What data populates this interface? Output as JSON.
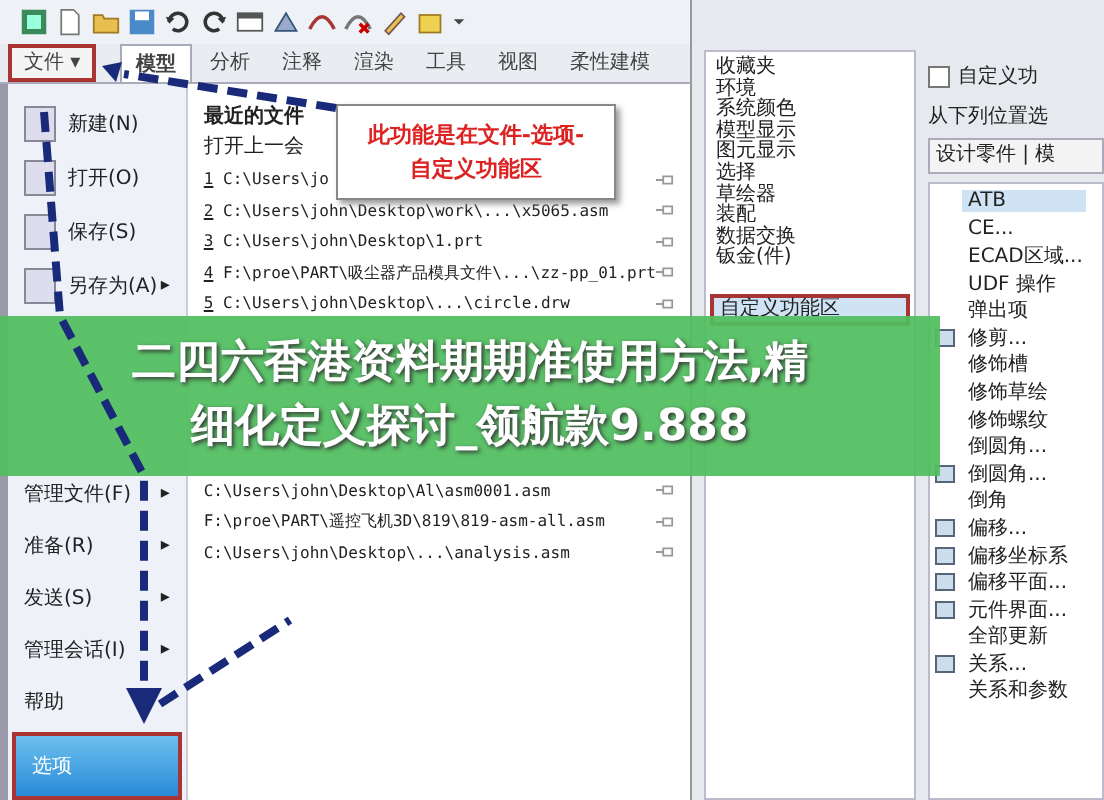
{
  "tabs": [
    {
      "label": "文件",
      "caret": "▾",
      "kind": "menu",
      "selected": false
    },
    {
      "label": "模型",
      "kind": "tab",
      "selected": true
    },
    {
      "label": "分析",
      "kind": "tab",
      "selected": false
    },
    {
      "label": "注释",
      "kind": "tab",
      "selected": false
    },
    {
      "label": "渲染",
      "kind": "tab",
      "selected": false
    },
    {
      "label": "工具",
      "kind": "tab",
      "selected": false
    },
    {
      "label": "视图",
      "kind": "tab",
      "selected": false
    },
    {
      "label": "柔性建模",
      "kind": "tab",
      "selected": false
    }
  ],
  "file_menu": {
    "items_top": [
      {
        "label": "新建(N)",
        "selected": false
      },
      {
        "label": "打开(O)",
        "selected": false
      },
      {
        "label": "保存(S)",
        "selected": false
      },
      {
        "label": "另存为(A)",
        "arrow": "▸",
        "selected": false
      }
    ],
    "items_bottom": [
      {
        "label": "管理文件(F)",
        "arrow": "▸",
        "selected": false
      },
      {
        "label": "准备(R)",
        "arrow": "▸",
        "selected": false
      },
      {
        "label": "发送(S)",
        "arrow": "▸",
        "selected": false
      },
      {
        "label": "管理会话(I)",
        "arrow": "▸",
        "selected": false
      },
      {
        "label": "帮助",
        "selected": false
      },
      {
        "label": "选项",
        "selected": true
      }
    ]
  },
  "recent_files": {
    "header": "最近的文件",
    "reopen": "打开上一会",
    "rows_top": [
      {
        "number": "1",
        "path": "C:\\Users\\jo"
      },
      {
        "number": "2",
        "path": "C:\\Users\\john\\Desktop\\work\\...\\x5065.asm"
      },
      {
        "number": "3",
        "path": "C:\\Users\\john\\Desktop\\1.prt"
      },
      {
        "number": "4",
        "path": "F:\\proe\\PART\\吸尘器产品模具文件\\...\\zz-pp_01.prt"
      },
      {
        "number": "5",
        "path": "C:\\Users\\john\\Desktop\\...\\circle.drw"
      }
    ],
    "rows_bottom": [
      {
        "path": "C:\\Users\\john\\Desktop\\Al\\asm0001.asm"
      },
      {
        "path": "F:\\proe\\PART\\遥控飞机3D\\819\\819-asm-all.asm"
      },
      {
        "path": "C:\\Users\\john\\Desktop\\...\\analysis.asm"
      }
    ]
  },
  "callout": {
    "lines": [
      "此功能是在文件-选项-",
      "自定义功能区"
    ]
  },
  "options_dialog": {
    "categories": [
      {
        "label": "收藏夹",
        "selected": false
      },
      {
        "label": "环境",
        "selected": false
      },
      {
        "label": "系统颜色",
        "selected": false
      },
      {
        "label": "模型显示",
        "selected": false
      },
      {
        "label": "图元显示",
        "selected": false
      },
      {
        "label": "选择",
        "selected": false
      },
      {
        "label": "草绘器",
        "selected": false
      },
      {
        "label": "装配",
        "selected": false
      },
      {
        "label": "数据交换",
        "selected": false
      },
      {
        "label": "钣金(件)",
        "selected": false
      },
      {
        "label": "自定义功能区",
        "selected": true
      }
    ],
    "customize_checkbox": {
      "label": "自定义功",
      "checked": false
    },
    "choose_from": "从下列位置选",
    "source_dropdown": "设计零件 | 模",
    "commands": [
      {
        "label": "ATB",
        "kind": "plain",
        "selected": true
      },
      {
        "label": "CE...",
        "kind": "plain",
        "selected": false
      },
      {
        "label": "ECAD区域...",
        "kind": "plain",
        "selected": false
      },
      {
        "label": "UDF 操作",
        "kind": "plain",
        "selected": false
      },
      {
        "label": "弹出项",
        "kind": "plain",
        "selected": false
      },
      {
        "label": "修剪...",
        "kind": "icon",
        "selected": false
      },
      {
        "label": "修饰槽",
        "kind": "plain",
        "selected": false
      },
      {
        "label": "修饰草绘",
        "kind": "plain",
        "selected": false
      },
      {
        "label": "修饰螺纹",
        "kind": "plain",
        "selected": false
      },
      {
        "label": "倒圆角...",
        "kind": "plain",
        "selected": false
      },
      {
        "label": "倒圆角...",
        "kind": "icon",
        "selected": false
      },
      {
        "label": "倒角",
        "kind": "plain",
        "selected": false
      },
      {
        "label": "偏移...",
        "kind": "icon",
        "selected": false
      },
      {
        "label": "偏移坐标系",
        "kind": "icon",
        "selected": false
      },
      {
        "label": "偏移平面...",
        "kind": "icon",
        "selected": false
      },
      {
        "label": "元件界面...",
        "kind": "icon",
        "selected": false
      },
      {
        "label": "全部更新",
        "kind": "plain",
        "selected": false
      },
      {
        "label": "关系...",
        "kind": "icon",
        "selected": false
      },
      {
        "label": "关系和参数",
        "kind": "plain",
        "selected": false
      }
    ]
  },
  "banner": {
    "lines": [
      "二四六香港资料期期准使用方法,精",
      "细化定义探讨_领航款9.888"
    ]
  }
}
